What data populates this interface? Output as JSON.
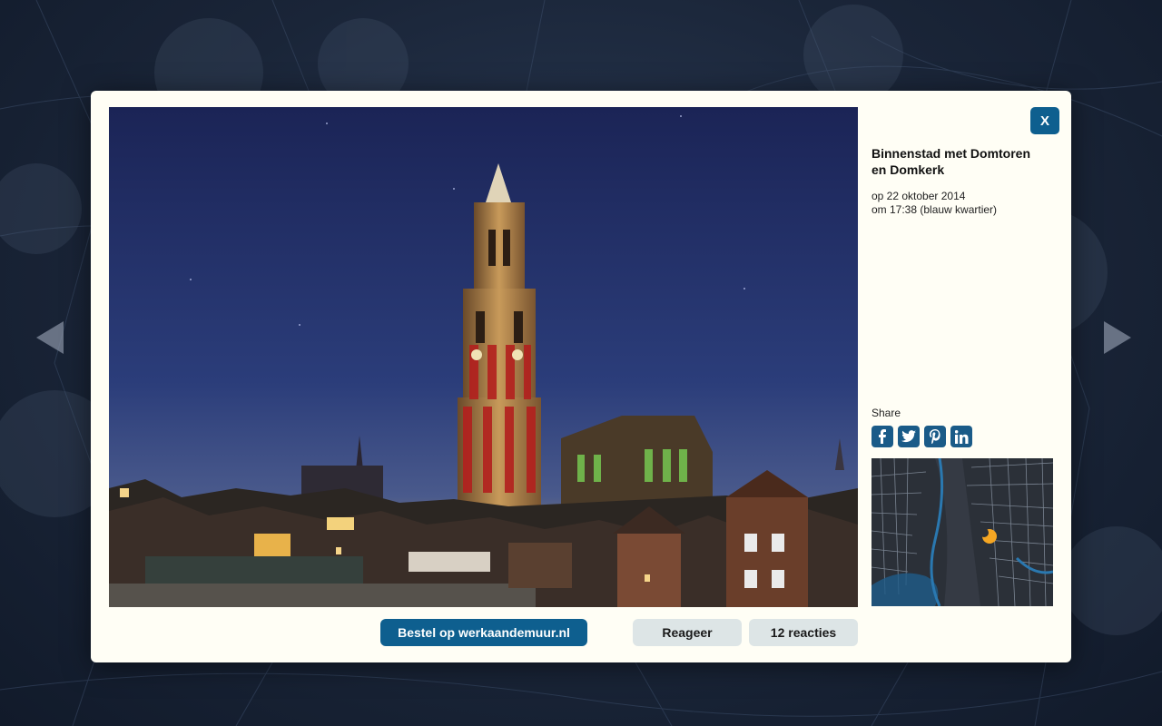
{
  "photo": {
    "alt": "Binnenstad met Domtoren en Domkerk"
  },
  "info": {
    "title": "Binnenstad met Domtoren en Domkerk",
    "date_line": "op 22 oktober 2014",
    "time_line": "om 17:38 (blauw kwartier)"
  },
  "close": {
    "label": "X"
  },
  "share": {
    "label": "Share",
    "icons": [
      "facebook-icon",
      "twitter-icon",
      "pinterest-icon",
      "linkedin-icon"
    ]
  },
  "actions": {
    "order_label": "Bestel op werkaandemuur.nl",
    "react_label": "Reageer",
    "reactions_label": "12 reacties"
  },
  "colors": {
    "accent": "#0e5f8f",
    "modal_bg": "#fffef5",
    "secondary_button": "#dde5e6",
    "map_marker": "#f5a623"
  }
}
